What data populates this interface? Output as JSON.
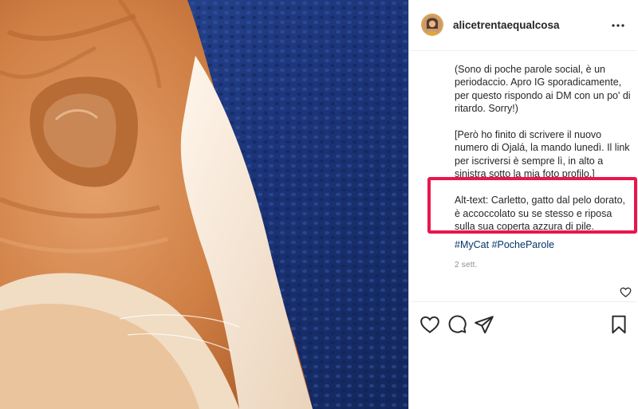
{
  "post": {
    "username": "alicetrentaequalcosa",
    "caption": {
      "paragraph_1": "(Sono di poche parole social, è un periodaccio. Apro IG sporadicamente, per questo rispondo ai DM con un po' di ritardo. Sorry!)",
      "paragraph_2": "[Però ho finito di scrivere il nuovo numero di Ojalá, la mando lunedì. Il link per iscriversi è sempre lì, in alto a sinistra sotto la mia foto profilo.]",
      "alt_text": "Alt-text: Carletto, gatto dal pelo dorato, è accoccolato su se stesso e riposa sulla sua coperta azzura di pile.",
      "hashtags": [
        "#MyCat",
        "#PocheParole"
      ]
    },
    "timestamp": "2 sett.",
    "icons": {
      "more": "more-options-icon",
      "small_like": "heart-icon",
      "like": "heart-icon",
      "comment": "comment-icon",
      "share": "share-icon",
      "save": "bookmark-icon"
    }
  },
  "colors": {
    "highlight": "#e8174d",
    "text": "#262626",
    "hashtag": "#00376b",
    "muted": "#8e8e8e",
    "cat_fur": "#d9894d",
    "blanket": "#1f3a80"
  }
}
